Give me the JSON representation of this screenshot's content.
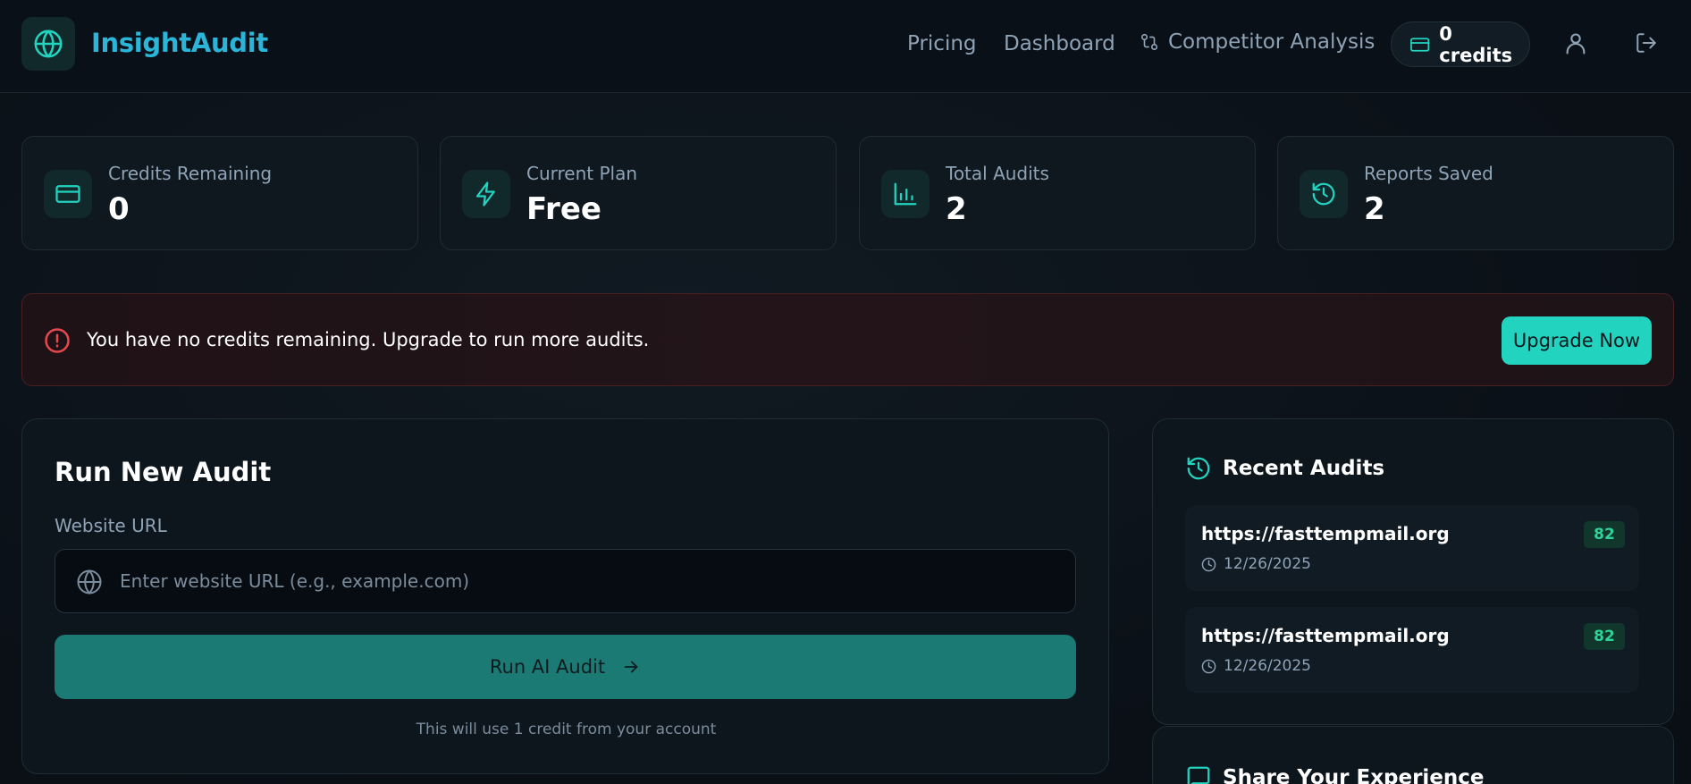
{
  "header": {
    "brand": "InsightAudit",
    "nav": {
      "pricing": "Pricing",
      "dashboard": "Dashboard",
      "competitor_analysis": "Competitor Analysis"
    },
    "credits_label": "0 credits"
  },
  "stats": [
    {
      "label": "Credits Remaining",
      "value": "0",
      "icon": "credit-card-icon"
    },
    {
      "label": "Current Plan",
      "value": "Free",
      "icon": "lightning-icon"
    },
    {
      "label": "Total Audits",
      "value": "2",
      "icon": "bar-chart-icon"
    },
    {
      "label": "Reports Saved",
      "value": "2",
      "icon": "history-icon"
    }
  ],
  "alert": {
    "message": "You have no credits remaining. Upgrade to run more audits.",
    "button": "Upgrade Now"
  },
  "audit_form": {
    "title": "Run New Audit",
    "url_label": "Website URL",
    "url_placeholder": "Enter website URL (e.g., example.com)",
    "url_value": "",
    "run_button": "Run AI Audit",
    "note": "This will use 1 credit from your account"
  },
  "recent": {
    "title": "Recent Audits",
    "items": [
      {
        "url": "https://fasttempmail.org",
        "date": "12/26/2025",
        "score": "82"
      },
      {
        "url": "https://fasttempmail.org",
        "date": "12/26/2025",
        "score": "82"
      }
    ]
  },
  "share": {
    "title": "Share Your Experience"
  },
  "colors": {
    "accent": "#22d3c0",
    "brand": "#2bb5d8",
    "alert_border": "#4a1f24",
    "alert_icon": "#e5484d",
    "score_badge": "#2fd39a"
  }
}
